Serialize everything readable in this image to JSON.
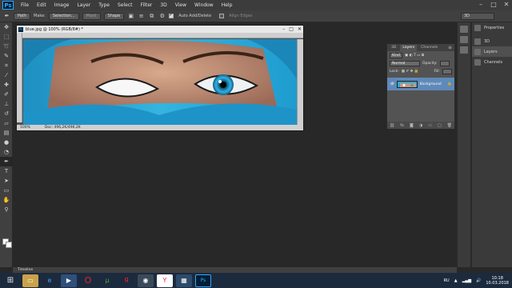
{
  "app": {
    "logo": "Ps"
  },
  "menu": [
    "File",
    "Edit",
    "Image",
    "Layer",
    "Type",
    "Select",
    "Filter",
    "3D",
    "View",
    "Window",
    "Help"
  ],
  "window_controls": [
    "–",
    "□",
    "✕"
  ],
  "options": {
    "mode": "Path",
    "make_label": "Make:",
    "selection_btn": "Selection...",
    "mask_btn": "Mask",
    "shape_btn": "Shape",
    "auto_add_delete": "Auto Add/Delete",
    "align_edges": "Align Edges",
    "workspace": "3D"
  },
  "tools": [
    "move-tool",
    "marquee-tool",
    "lasso-tool",
    "quick-select-tool",
    "crop-tool",
    "eyedropper-tool",
    "healing-tool",
    "brush-tool",
    "clone-tool",
    "history-brush-tool",
    "eraser-tool",
    "gradient-tool",
    "blur-tool",
    "dodge-tool",
    "pen-tool",
    "type-tool",
    "path-select-tool",
    "rectangle-tool",
    "hand-tool",
    "zoom-tool"
  ],
  "document": {
    "title": "blue.jpg @ 100% (RGB/8#) *",
    "zoom": "100%",
    "doc_size": "Doc: 496,2K/496,2K"
  },
  "panels": {
    "items": [
      {
        "label": "Properties",
        "icon": "properties-icon"
      },
      {
        "label": "3D",
        "icon": "3d-icon"
      },
      {
        "label": "Layers",
        "icon": "layers-icon"
      },
      {
        "label": "Channels",
        "icon": "channels-icon"
      }
    ]
  },
  "layers_panel": {
    "tabs": [
      "3D",
      "Layers",
      "Channels"
    ],
    "kind_filter": "Kind",
    "blend_mode": "Normal",
    "opacity_label": "Opacity:",
    "lock_label": "Lock:",
    "fill_label": "Fill:",
    "layer_name": "Background"
  },
  "timeline": {
    "label": "Timeline"
  },
  "taskbar": {
    "apps": [
      "explorer",
      "ie",
      "media",
      "opera",
      "utorrent",
      "yandex",
      "tor",
      "yandex-browser",
      "gallery",
      "photoshop"
    ],
    "lang": "RU",
    "time": "10:18",
    "date": "10.03.2018"
  },
  "colors": {
    "photo_bg": "#2aa9d6",
    "iris": "#2b9fd4",
    "layer_selected": "#5f89b8"
  }
}
